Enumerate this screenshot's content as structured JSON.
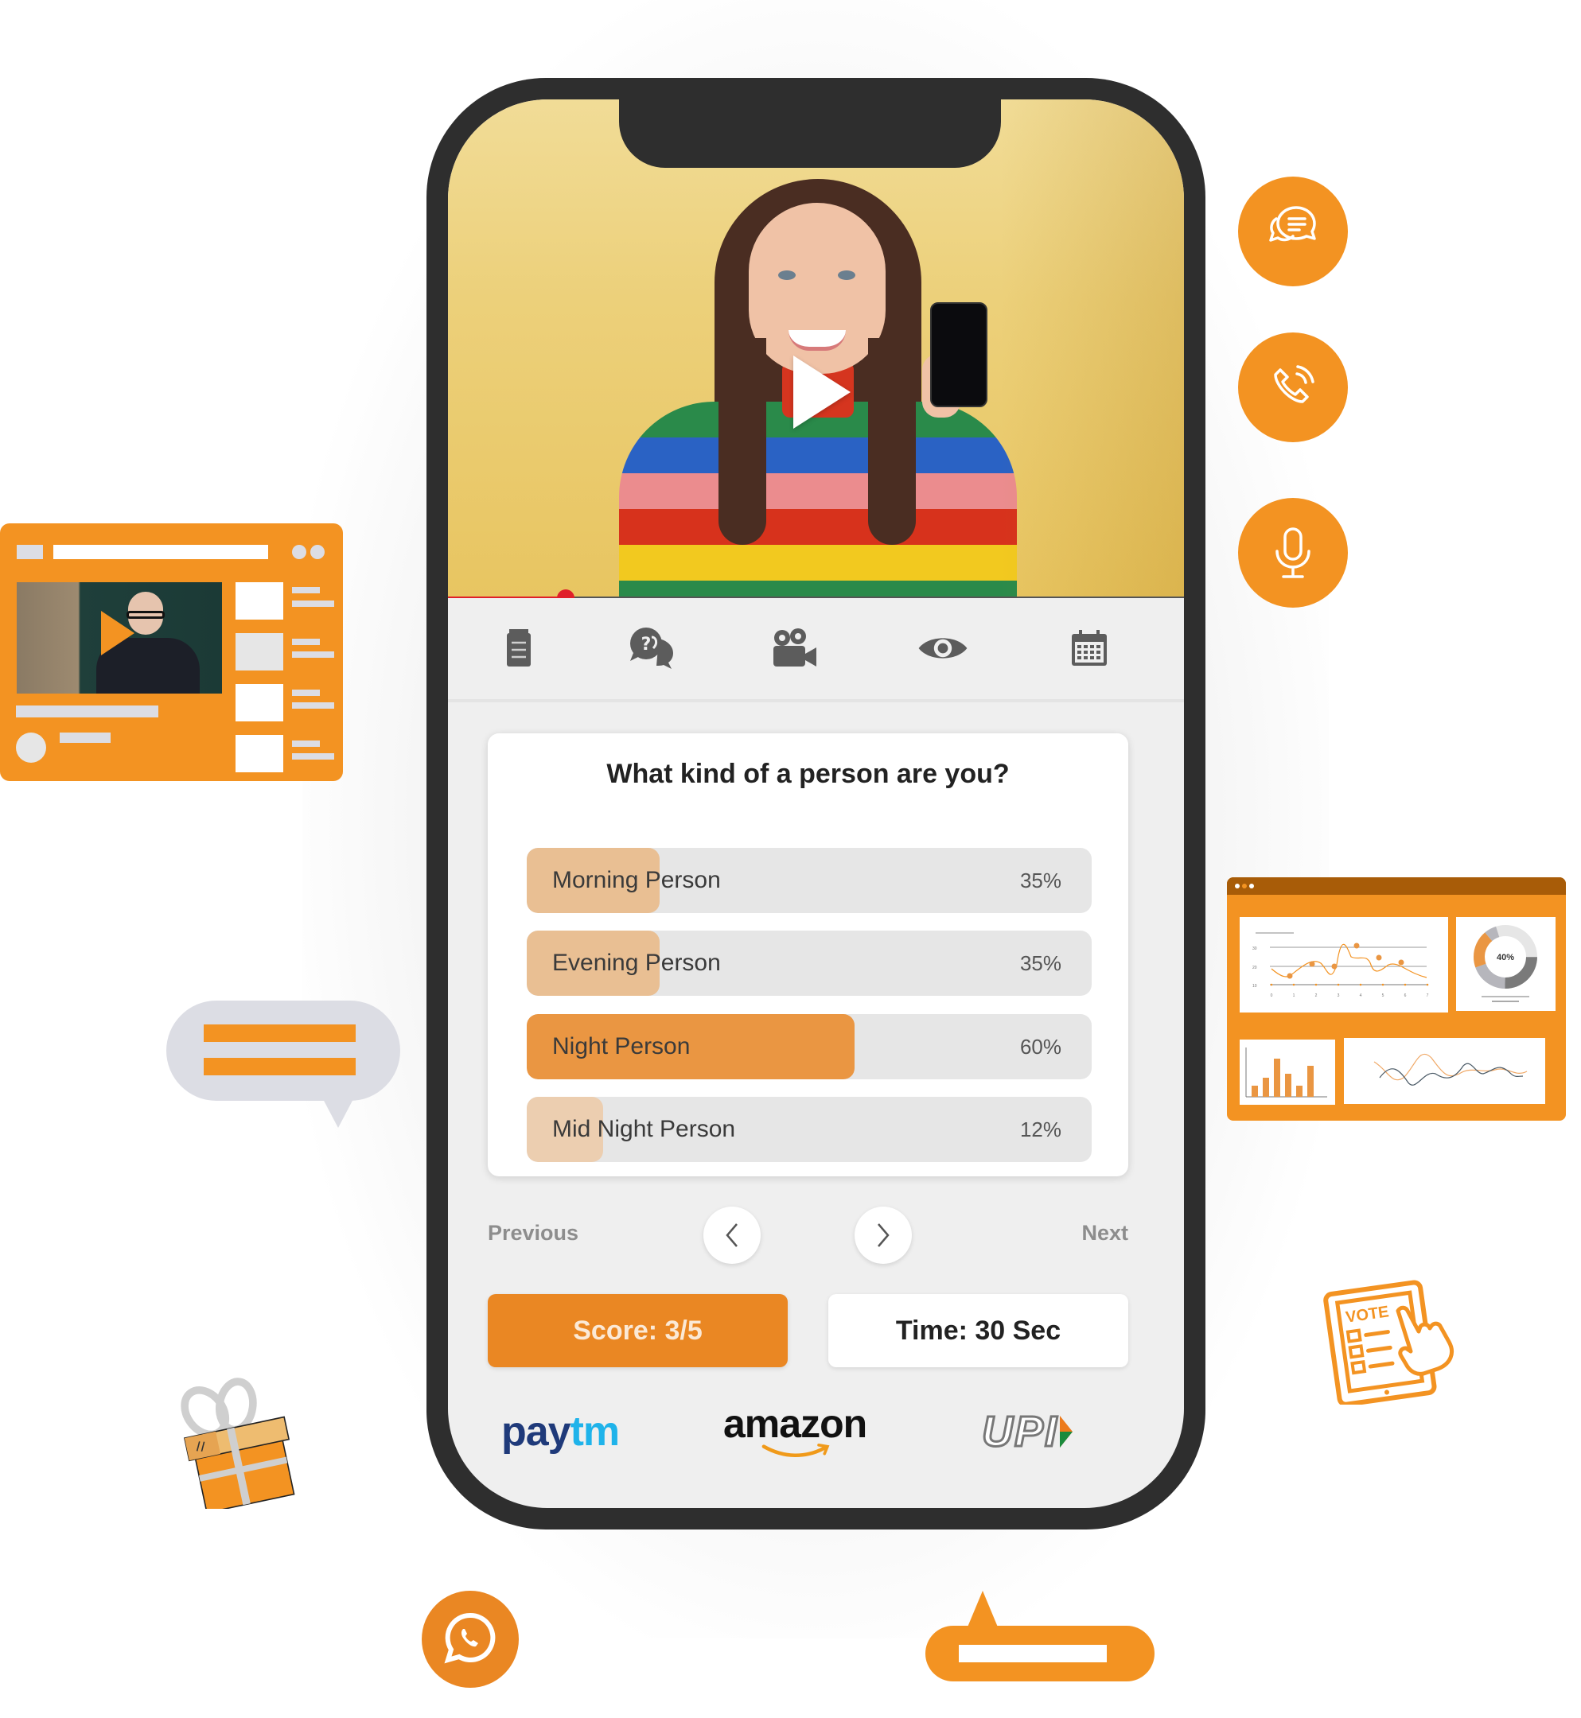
{
  "video": {
    "progress_percent": 16,
    "play_icon": "play-icon"
  },
  "toolbar": {
    "items": [
      {
        "name": "notes",
        "icon": "notepad-icon"
      },
      {
        "name": "qna",
        "icon": "question-chat-icon"
      },
      {
        "name": "video",
        "icon": "video-camera-icon"
      },
      {
        "name": "views",
        "icon": "eye-icon"
      },
      {
        "name": "schedule",
        "icon": "calendar-icon"
      }
    ]
  },
  "poll": {
    "question": "What kind of a person are you?",
    "options": [
      {
        "label": "Morning Person",
        "percent_text": "35%",
        "fill_fraction": 0.235,
        "fill_color": "#e9bf93"
      },
      {
        "label": "Evening Person",
        "percent_text": "35%",
        "fill_fraction": 0.235,
        "fill_color": "#e9bf93"
      },
      {
        "label": "Night Person",
        "percent_text": "60%",
        "fill_fraction": 0.58,
        "fill_color": "#ea9642"
      },
      {
        "label": "Mid Night Person",
        "percent_text": "12%",
        "fill_fraction": 0.135,
        "fill_color": "#ecceb0"
      }
    ]
  },
  "navigation": {
    "previous_label": "Previous",
    "next_label": "Next"
  },
  "stats": {
    "score_label": "Score:  3/5",
    "time_label": "Time: 30 Sec"
  },
  "payments": {
    "paytm_pay": "pay",
    "paytm_tm": "tm",
    "amazon": "amazon",
    "upi": "UPI"
  },
  "side_actions": [
    {
      "name": "chat",
      "icon": "chat-bubbles-icon"
    },
    {
      "name": "call",
      "icon": "phone-call-icon"
    },
    {
      "name": "mic",
      "icon": "microphone-icon"
    }
  ],
  "dashboard": {
    "donut_label": "40%",
    "line_y_ticks": [
      "30",
      "20",
      "10"
    ],
    "line_x_ticks": [
      "0",
      "1",
      "2",
      "3",
      "4",
      "5",
      "6",
      "7"
    ]
  },
  "vote_icon_text": "VOTE",
  "colors": {
    "accent": "#f39322",
    "accent_dark": "#ea8723",
    "bezel": "#2e2e2e",
    "progress": "#e0202a"
  }
}
